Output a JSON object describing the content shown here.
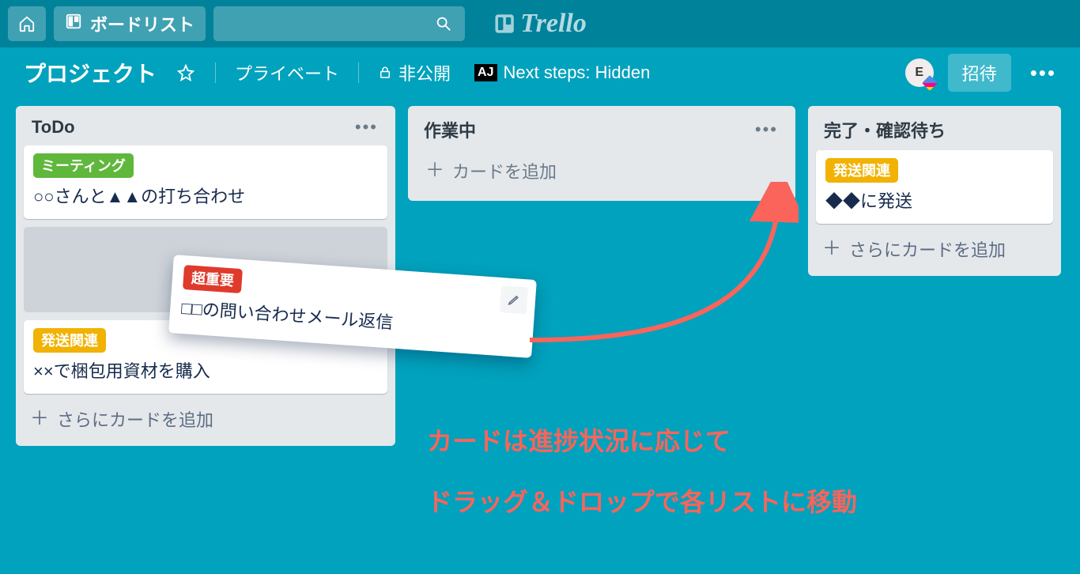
{
  "nav": {
    "boards_label": "ボードリスト"
  },
  "brand": {
    "name": "Trello"
  },
  "header": {
    "board_title": "プロジェクト",
    "privacy_team": "プライベート",
    "visibility": "非公開",
    "powerup": "Next steps: Hidden",
    "avatar_initial": "E",
    "invite_label": "招待"
  },
  "lists": [
    {
      "title": "ToDo",
      "cards": [
        {
          "label": "ミーティング",
          "label_color": "green",
          "text": "○○さんと▲▲の打ち合わせ"
        },
        {
          "placeholder": true
        },
        {
          "label": "発送関連",
          "label_color": "yellow",
          "text": "××で梱包用資材を購入"
        }
      ],
      "add_label": "さらにカードを追加"
    },
    {
      "title": "作業中",
      "cards": [],
      "add_label": "カードを追加"
    },
    {
      "title": "完了・確認待ち",
      "cards": [
        {
          "label": "発送関連",
          "label_color": "yellow",
          "text": "◆◆に発送"
        }
      ],
      "add_label": "さらにカードを追加"
    }
  ],
  "dragged_card": {
    "label": "超重要",
    "label_color": "red",
    "text": "□□の問い合わせメール返信"
  },
  "annotation": {
    "line1": "カードは進捗状況に応じて",
    "line2": "ドラッグ＆ドロップで各リストに移動"
  }
}
